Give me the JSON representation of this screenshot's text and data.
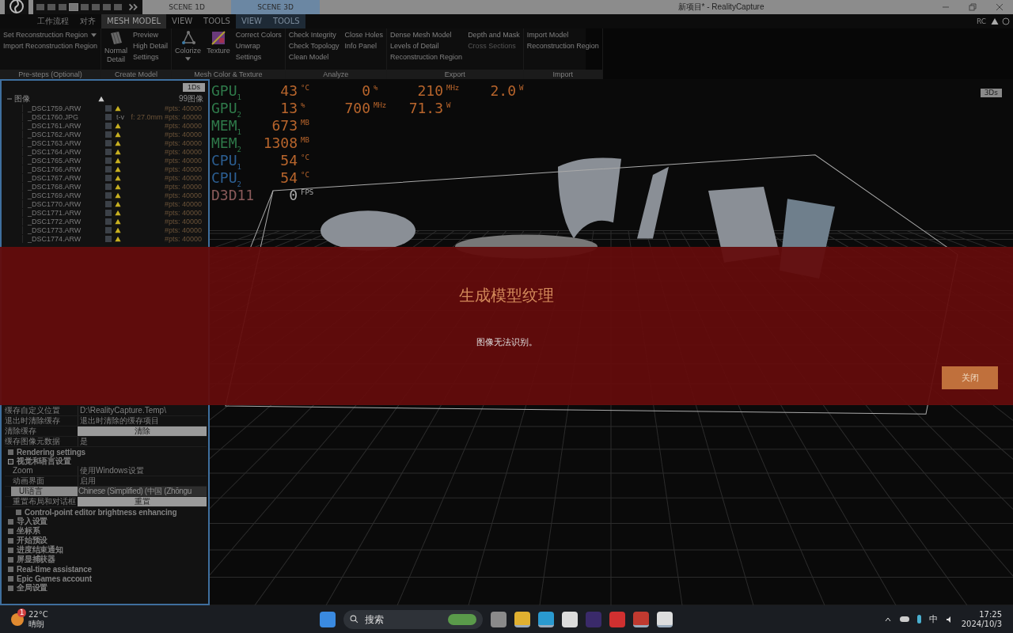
{
  "window": {
    "title": "新项目* - RealityCapture"
  },
  "scene_tabs": [
    {
      "label": "SCENE 1D",
      "selected": false
    },
    {
      "label": "SCENE 3D",
      "selected": true
    }
  ],
  "menu": [
    {
      "label": "工作流程",
      "selected": false,
      "contextual": false
    },
    {
      "label": "对齐",
      "selected": false,
      "contextual": false
    },
    {
      "label": "MESH MODEL",
      "selected": true,
      "contextual": false
    },
    {
      "label": "VIEW",
      "selected": false,
      "contextual": false
    },
    {
      "label": "TOOLS",
      "selected": false,
      "contextual": false
    },
    {
      "label": "VIEW",
      "selected": false,
      "contextual": true
    },
    {
      "label": "TOOLS",
      "selected": false,
      "contextual": true
    }
  ],
  "header_right": {
    "badge": "RC"
  },
  "ribbon": [
    {
      "label": "Pre-steps (Optional)",
      "columns": [
        [
          {
            "kind": "dropdown",
            "label": "Set Reconstruction Region",
            "disabled": false
          },
          {
            "kind": "text",
            "label": "Import Reconstruction Region",
            "disabled": false
          }
        ]
      ]
    },
    {
      "label": "Create Model",
      "columns": [
        [
          {
            "kind": "mesh",
            "label": "Normal Detail",
            "disabled": false
          }
        ],
        [
          {
            "kind": "text",
            "label": "Preview",
            "disabled": false
          },
          {
            "kind": "text",
            "label": "High Detail",
            "disabled": false
          },
          {
            "kind": "text",
            "label": "Settings",
            "disabled": false
          }
        ]
      ]
    },
    {
      "label": "Mesh Color & Texture",
      "columns": [
        [
          {
            "kind": "colorize",
            "label": "Colorize",
            "disabled": false
          }
        ],
        [
          {
            "kind": "texture",
            "label": "Texture",
            "disabled": false
          }
        ],
        [
          {
            "kind": "text",
            "label": "Correct Colors",
            "disabled": false
          },
          {
            "kind": "text",
            "label": "Unwrap",
            "disabled": false
          },
          {
            "kind": "text",
            "label": "Settings",
            "disabled": false
          }
        ]
      ]
    },
    {
      "label": "Analyze",
      "columns": [
        [
          {
            "kind": "text",
            "label": "Check Integrity",
            "disabled": false
          },
          {
            "kind": "text",
            "label": "Check Topology",
            "disabled": false
          },
          {
            "kind": "text",
            "label": "Clean Model",
            "disabled": false
          }
        ],
        [
          {
            "kind": "text",
            "label": "Close Holes",
            "disabled": false
          },
          {
            "kind": "text",
            "label": "Info Panel",
            "disabled": false
          }
        ]
      ]
    },
    {
      "label": "Export",
      "columns": [
        [
          {
            "kind": "text",
            "label": "Dense Mesh Model",
            "disabled": false
          },
          {
            "kind": "text",
            "label": "Levels of Detail",
            "disabled": false
          },
          {
            "kind": "text",
            "label": "Reconstruction Region",
            "disabled": false
          }
        ],
        [
          {
            "kind": "text",
            "label": "Depth and Mask",
            "disabled": false
          },
          {
            "kind": "text",
            "label": "Cross Sections",
            "disabled": true
          }
        ]
      ]
    },
    {
      "label": "Import",
      "columns": [
        [
          {
            "kind": "text",
            "label": "Import Model",
            "disabled": false
          },
          {
            "kind": "text",
            "label": "Reconstruction Region",
            "disabled": false
          }
        ]
      ]
    }
  ],
  "left_panel": {
    "view_button": "1Ds",
    "tree_root": "图像",
    "image_count": "99图像",
    "images": [
      {
        "name": "_DSC1759.ARW",
        "warning": true,
        "info": "#pts: 40000"
      },
      {
        "name": "_DSC1760.JPG",
        "warning": false,
        "lens": "t-v",
        "info": "f: 27.0mm #pts: 40000"
      },
      {
        "name": "_DSC1761.ARW",
        "warning": true,
        "info": "#pts: 40000"
      },
      {
        "name": "_DSC1762.ARW",
        "warning": true,
        "info": "#pts: 40000"
      },
      {
        "name": "_DSC1763.ARW",
        "warning": true,
        "info": "#pts: 40000"
      },
      {
        "name": "_DSC1764.ARW",
        "warning": true,
        "info": "#pts: 40000"
      },
      {
        "name": "_DSC1765.ARW",
        "warning": true,
        "info": "#pts: 40000"
      },
      {
        "name": "_DSC1766.ARW",
        "warning": true,
        "info": "#pts: 40000"
      },
      {
        "name": "_DSC1767.ARW",
        "warning": true,
        "info": "#pts: 40000"
      },
      {
        "name": "_DSC1768.ARW",
        "warning": true,
        "info": "#pts: 40000"
      },
      {
        "name": "_DSC1769.ARW",
        "warning": true,
        "info": "#pts: 40000"
      },
      {
        "name": "_DSC1770.ARW",
        "warning": true,
        "info": "#pts: 40000"
      },
      {
        "name": "_DSC1771.ARW",
        "warning": true,
        "info": "#pts: 40000"
      },
      {
        "name": "_DSC1772.ARW",
        "warning": true,
        "info": "#pts: 40000"
      },
      {
        "name": "_DSC1773.ARW",
        "warning": true,
        "info": "#pts: 40000"
      },
      {
        "name": "_DSC1774.ARW",
        "warning": true,
        "info": "#pts: 40000"
      }
    ],
    "settings": [
      {
        "kind": "value",
        "label": "缓存自定义位置",
        "value": "D:\\RealityCapture.Temp\\"
      },
      {
        "kind": "value",
        "label": "退出时清除缓存",
        "value": "退出时清除的缓存项目"
      },
      {
        "kind": "button",
        "label": "清除缓存",
        "value": "清除"
      },
      {
        "kind": "value",
        "label": "缓存图像元数据",
        "value": "是"
      },
      {
        "kind": "section",
        "label": "Rendering settings",
        "expanded": false
      },
      {
        "kind": "section",
        "label": "视觉和语言设置",
        "expanded": true,
        "children": [
          {
            "kind": "value",
            "label": "Zoom",
            "value": "使用Windows设置",
            "selected": false
          },
          {
            "kind": "value",
            "label": "动画界面",
            "value": "启用",
            "selected": false
          },
          {
            "kind": "dropdown",
            "label": "UI语言",
            "value": "Chinese (Simplified) (中国 (Zhōngu",
            "selected": true
          },
          {
            "kind": "button",
            "label": "重置布局和对话框",
            "value": "重置",
            "selected": false
          },
          {
            "kind": "section",
            "label": "Control-point editor brightness enhancing",
            "expanded": false
          }
        ]
      },
      {
        "kind": "section",
        "label": "导入设置",
        "expanded": false
      },
      {
        "kind": "section",
        "label": "坐标系",
        "expanded": false
      },
      {
        "kind": "section",
        "label": "开始预设",
        "expanded": false
      },
      {
        "kind": "section",
        "label": "进度结束通知",
        "expanded": false
      },
      {
        "kind": "section",
        "label": "屏显捕获器",
        "expanded": false
      },
      {
        "kind": "section",
        "label": "Real-time assistance",
        "expanded": false
      },
      {
        "kind": "section",
        "label": "Epic Games account",
        "expanded": false
      },
      {
        "kind": "section",
        "label": "全局设置",
        "expanded": false
      }
    ]
  },
  "viewport": {
    "view_button": "3Ds",
    "hud": [
      {
        "kind": "sensor",
        "label": "GPU",
        "sub": "1",
        "color": "#2f7a4a",
        "values": [
          {
            "value": "43",
            "unit": "°C"
          },
          {
            "value": "0",
            "unit": "%"
          },
          {
            "value": "210",
            "unit": "MHz"
          },
          {
            "value": "2.0",
            "unit": "W"
          }
        ]
      },
      {
        "kind": "sensor",
        "label": "GPU",
        "sub": "2",
        "color": "#2f7a4a",
        "values": [
          {
            "value": "13",
            "unit": "%"
          },
          {
            "value": "700",
            "unit": "MHz"
          },
          {
            "value": "71.3",
            "unit": "W"
          }
        ]
      },
      {
        "kind": "sensor",
        "label": "MEM",
        "sub": "1",
        "color": "#2f7a4a",
        "values": [
          {
            "value": "673",
            "unit": "MB"
          }
        ]
      },
      {
        "kind": "sensor",
        "label": "MEM",
        "sub": "2",
        "color": "#2f7a4a",
        "values": [
          {
            "value": "1308",
            "unit": "MB"
          }
        ]
      },
      {
        "kind": "sensor",
        "label": "CPU",
        "sub": "1",
        "color": "#2c5f93",
        "values": [
          {
            "value": "54",
            "unit": "°C"
          }
        ]
      },
      {
        "kind": "sensor",
        "label": "CPU",
        "sub": "2",
        "color": "#2c5f93",
        "values": [
          {
            "value": "54",
            "unit": "°C"
          }
        ]
      },
      {
        "kind": "fps",
        "label": "D3D11",
        "color": "#8a5a5a",
        "values": [
          {
            "value": "0",
            "unit": "FPS"
          }
        ]
      }
    ]
  },
  "dialog": {
    "title": "生成模型纹理",
    "message": "图像无法识别。",
    "button": "关闭"
  },
  "taskbar": {
    "weather": {
      "temperature": "22°C",
      "condition": "晴朗",
      "badge": "1"
    },
    "search": {
      "placeholder": "搜索"
    },
    "apps": [
      {
        "kind": "windows",
        "active": false
      },
      {
        "kind": "taskview",
        "active": false
      },
      {
        "kind": "folder",
        "active": true
      },
      {
        "kind": "edge",
        "active": true
      },
      {
        "kind": "store",
        "active": false
      },
      {
        "kind": "bot",
        "active": false
      },
      {
        "kind": "wps",
        "active": false
      },
      {
        "kind": "chrome",
        "active": true
      },
      {
        "kind": "rc",
        "active": true
      }
    ],
    "ime": "中",
    "time": "17:25",
    "date": "2024/10/3"
  }
}
